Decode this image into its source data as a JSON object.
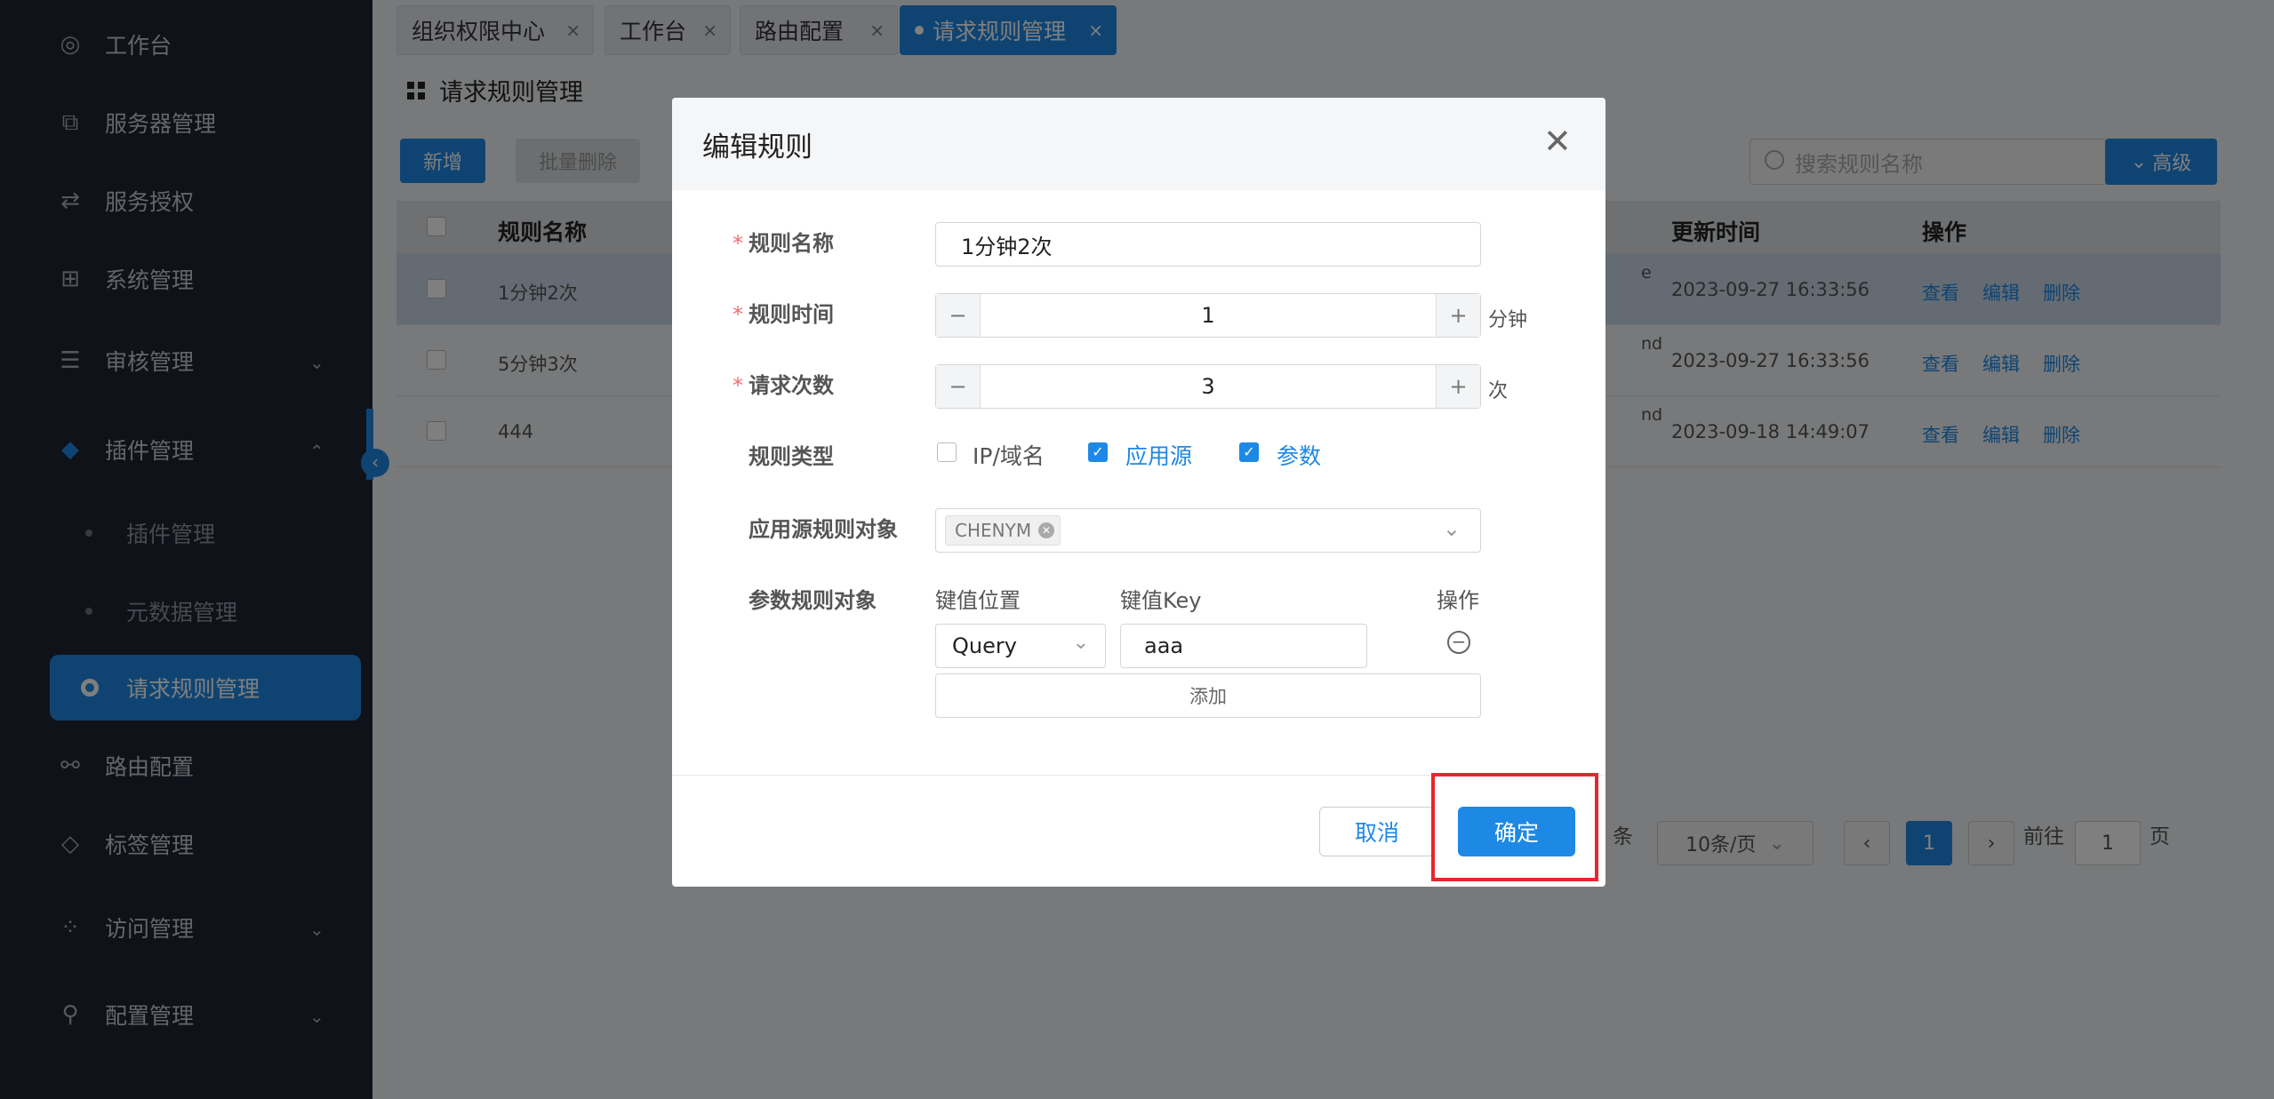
{
  "sidebar": {
    "items": [
      {
        "label": "工作台",
        "icon": "dashboard-icon"
      },
      {
        "label": "服务器管理",
        "icon": "server-icon"
      },
      {
        "label": "服务授权",
        "icon": "swap-icon"
      },
      {
        "label": "系统管理",
        "icon": "apps-icon"
      },
      {
        "label": "审核管理",
        "icon": "audit-icon"
      },
      {
        "label": "插件管理",
        "icon": "gem-icon"
      },
      {
        "label": "插件管理"
      },
      {
        "label": "元数据管理"
      },
      {
        "label": "请求规则管理"
      },
      {
        "label": "路由配置",
        "icon": "route-icon"
      },
      {
        "label": "标签管理",
        "icon": "tag-icon"
      },
      {
        "label": "访问管理",
        "icon": "access-icon"
      },
      {
        "label": "配置管理",
        "icon": "org-icon"
      }
    ]
  },
  "tabs": [
    {
      "label": "组织权限中心"
    },
    {
      "label": "工作台"
    },
    {
      "label": "路由配置"
    },
    {
      "label": "请求规则管理",
      "active": true
    }
  ],
  "page": {
    "title": "请求规则管理",
    "add_button": "新增",
    "batch_delete_button": "批量删除",
    "search_placeholder": "搜索规则名称",
    "advanced_button": "高级"
  },
  "table": {
    "headers": [
      "规则名称",
      "更新时间",
      "操作"
    ],
    "rows": [
      {
        "name": "1分钟2次",
        "desc_fragment": "e",
        "updated": "2023-09-27 16:33:56"
      },
      {
        "name": "5分钟3次",
        "desc_fragment": "nd",
        "updated": "2023-09-27 16:33:56"
      },
      {
        "name": "444",
        "desc_fragment": "nd",
        "updated": "2023-09-18 14:49:07"
      }
    ],
    "actions": [
      "查看",
      "编辑",
      "删除"
    ]
  },
  "pagination": {
    "total_suffix": "条",
    "page_size": "10条/页",
    "current_page": "1",
    "goto_label": "前往",
    "goto_value": "1",
    "page_suffix": "页"
  },
  "modal": {
    "title": "编辑规则",
    "fields": {
      "rule_name_label": "规则名称",
      "rule_name_value": "1分钟2次",
      "rule_time_label": "规则时间",
      "rule_time_value": "1",
      "rule_time_unit": "分钟",
      "request_count_label": "请求次数",
      "request_count_value": "3",
      "request_count_unit": "次",
      "rule_type_label": "规则类型",
      "rule_type_options": [
        {
          "label": "IP/域名",
          "checked": false
        },
        {
          "label": "应用源",
          "checked": true
        },
        {
          "label": "参数",
          "checked": true
        }
      ],
      "app_source_label": "应用源规则对象",
      "app_source_tags": [
        "CHENYM"
      ],
      "param_label": "参数规则对象",
      "param_col_position": "键值位置",
      "param_col_key": "键值Key",
      "param_col_action": "操作",
      "param_position_value": "Query",
      "param_key_value": "aaa",
      "add_param_button": "添加"
    },
    "cancel_button": "取消",
    "ok_button": "确定"
  },
  "colors": {
    "primary": "#1e88e5",
    "sidebar_bg": "#1f2533",
    "highlight_border": "#e8262d"
  }
}
